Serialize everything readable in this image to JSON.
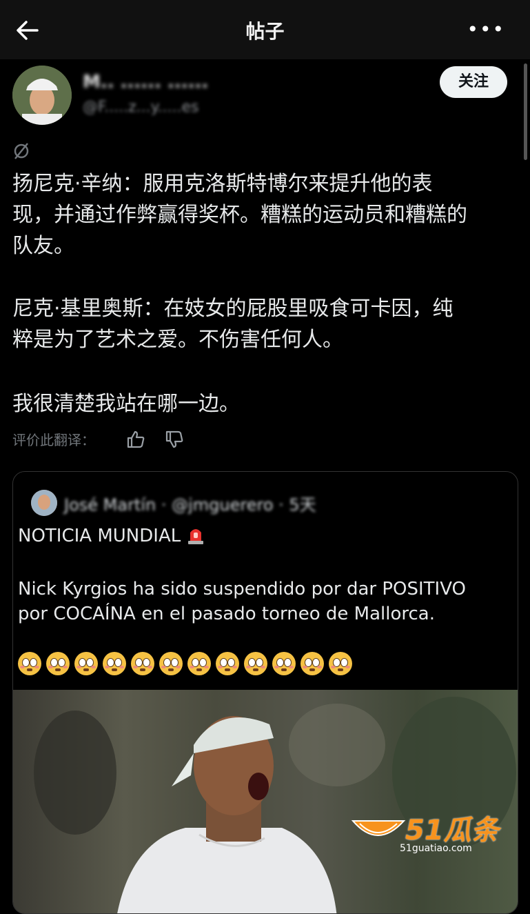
{
  "header": {
    "title": "帖子"
  },
  "post": {
    "author_name": "M.. ...... ......",
    "author_handle": "@F.....z...y.....es",
    "follow_label": "关注",
    "paragraphs": [
      [
        "扬尼克·辛纳：服用克洛斯特博尔来提升他的表",
        "现，并通过作弊赢得奖杯。糟糕的运动员和糟糕的",
        "队友。"
      ],
      [
        "尼克·基里奥斯：在妓女的屁股里吸食可卡因，纯",
        "粹是为了艺术之爱。不伤害任何人。"
      ],
      [
        "我很清楚我站在哪一边。"
      ]
    ],
    "rate_translation_label": "评价此翻译："
  },
  "quote": {
    "meta": "José Martín · @jmguerero · 5天",
    "line1": "NOTICIA MUNDIAL",
    "line2": "Nick Kyrgios ha sido suspendido por dar POSITIVO",
    "line3": "por COCAÍNA en el pasado torneo de Mallorca.",
    "emoji_count": 12,
    "emoji_name": "flushed-face"
  },
  "watermark": {
    "brand": "51瓜条",
    "url": "51guatiao.com",
    "color": "#f7931e"
  },
  "colors": {
    "background": "#000000",
    "topbar": "#111111",
    "muted": "#71767b",
    "follow_bg": "#eff3f4"
  }
}
